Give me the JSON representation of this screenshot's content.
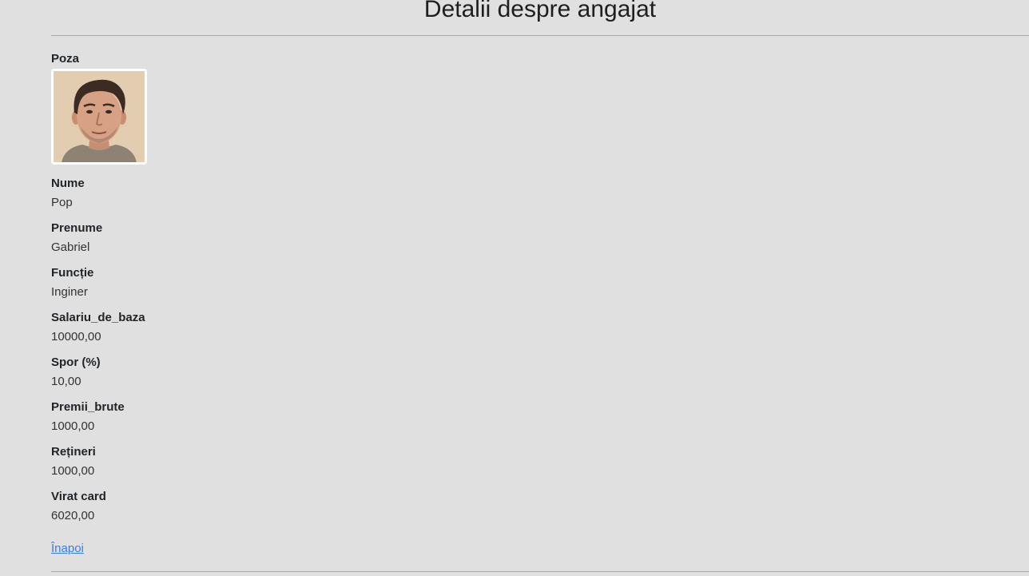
{
  "page": {
    "title": "Detalii despre angajat"
  },
  "employee": {
    "photo": {
      "label": "Poza",
      "icon": "employee-photo"
    },
    "fields": [
      {
        "label": "Nume",
        "value": "Pop"
      },
      {
        "label": "Prenume",
        "value": "Gabriel"
      },
      {
        "label": "Funcție",
        "value": "Inginer"
      },
      {
        "label": "Salariu_de_baza",
        "value": "10000,00"
      },
      {
        "label": "Spor (%)",
        "value": "10,00"
      },
      {
        "label": "Premii_brute",
        "value": "1000,00"
      },
      {
        "label": "Rețineri",
        "value": "1000,00"
      },
      {
        "label": "Virat card",
        "value": "6020,00"
      }
    ]
  },
  "nav": {
    "back_label": "Înapoi"
  },
  "colors": {
    "background": "#e0e0e0",
    "link": "#3b7ddd",
    "rule": "#a8a8a8"
  }
}
